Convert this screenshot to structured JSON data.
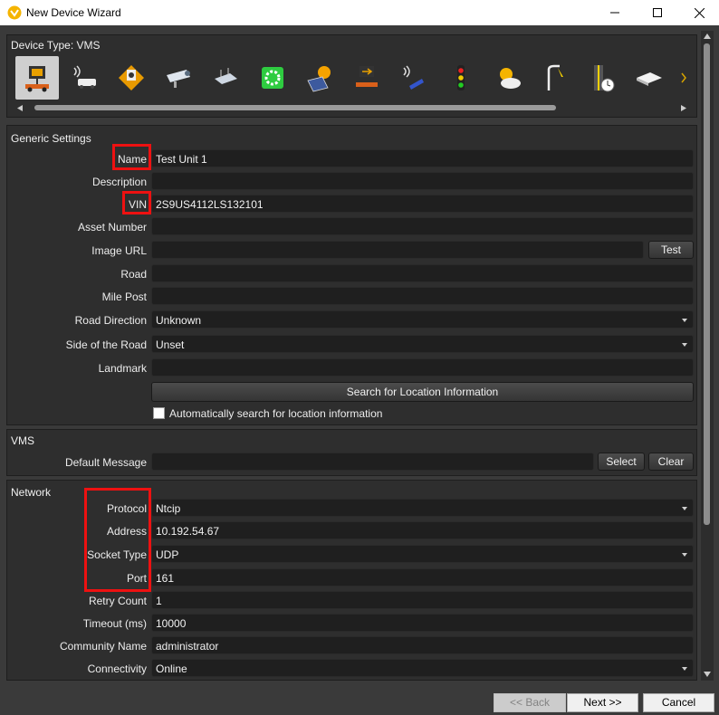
{
  "window": {
    "title": "New Device Wizard",
    "brand_color": "#f5b400"
  },
  "device_type": {
    "header": "Device Type: VMS",
    "icons": [
      "vms-trailer-icon",
      "radar-vehicle-icon",
      "camera-sign-icon",
      "cctv-camera-icon",
      "router-icon",
      "green-device-icon",
      "solar-panel-icon",
      "arrow-board-icon",
      "sensor-icon",
      "traffic-signal-icon",
      "weather-icon",
      "street-light-icon",
      "time-gate-icon",
      "switch-icon",
      "more-icon"
    ]
  },
  "generic": {
    "header": "Generic Settings",
    "name_label": "Name",
    "name_value": "Test Unit 1",
    "description_label": "Description",
    "description_value": "",
    "vin_label": "VIN",
    "vin_value": "2S9US4112LS132101",
    "asset_label": "Asset Number",
    "asset_value": "",
    "image_label": "Image URL",
    "image_value": "",
    "test_label": "Test",
    "road_label": "Road",
    "road_value": "",
    "milepost_label": "Mile Post",
    "milepost_value": "",
    "direction_label": "Road Direction",
    "direction_value": "Unknown",
    "side_label": "Side of the Road",
    "side_value": "Unset",
    "landmark_label": "Landmark",
    "landmark_value": "",
    "search_label": "Search for Location Information",
    "auto_search_label": "Automatically search for location information"
  },
  "vms": {
    "header": "VMS",
    "message_label": "Default Message",
    "message_value": "",
    "select_label": "Select",
    "clear_label": "Clear"
  },
  "network": {
    "header": "Network",
    "protocol_label": "Protocol",
    "protocol_value": "Ntcip",
    "address_label": "Address",
    "address_value": "10.192.54.67",
    "socket_label": "Socket Type",
    "socket_value": "UDP",
    "port_label": "Port",
    "port_value": "161",
    "retry_label": "Retry Count",
    "retry_value": "1",
    "timeout_label": "Timeout (ms)",
    "timeout_value": "10000",
    "community_label": "Community Name",
    "community_value": "administrator",
    "connectivity_label": "Connectivity",
    "connectivity_value": "Online"
  },
  "footer": {
    "back_label": "<< Back",
    "next_label": "Next >>",
    "cancel_label": "Cancel"
  },
  "highlight_color": "#e11111"
}
